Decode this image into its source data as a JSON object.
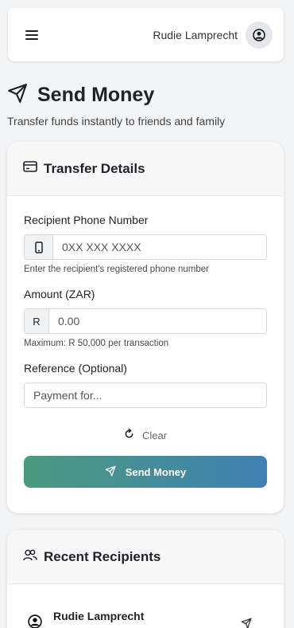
{
  "header": {
    "user_name": "Rudie Lamprecht"
  },
  "page": {
    "title": "Send Money",
    "subtitle": "Transfer funds instantly to friends and family"
  },
  "transfer_card": {
    "title": "Transfer Details",
    "phone": {
      "label": "Recipient Phone Number",
      "placeholder": "0XX XXX XXXX",
      "help": "Enter the recipient's registered phone number"
    },
    "amount": {
      "label": "Amount (ZAR)",
      "prefix": "R",
      "placeholder": "0.00",
      "help": "Maximum: R 50,000 per transaction"
    },
    "reference": {
      "label": "Reference (Optional)",
      "placeholder": "Payment for..."
    },
    "clear_label": "Clear",
    "send_label": "Send Money"
  },
  "recipients_card": {
    "title": "Recent Recipients",
    "items": [
      {
        "name": "Rudie Lamprecht"
      }
    ]
  },
  "colors": {
    "button_gradient_start": "#4a9b7f",
    "button_gradient_end": "#3f7fb2"
  },
  "icons": [
    "menu-icon",
    "user-circle-icon",
    "send-icon",
    "credit-card-icon",
    "phone-icon",
    "refresh-icon",
    "users-icon"
  ]
}
